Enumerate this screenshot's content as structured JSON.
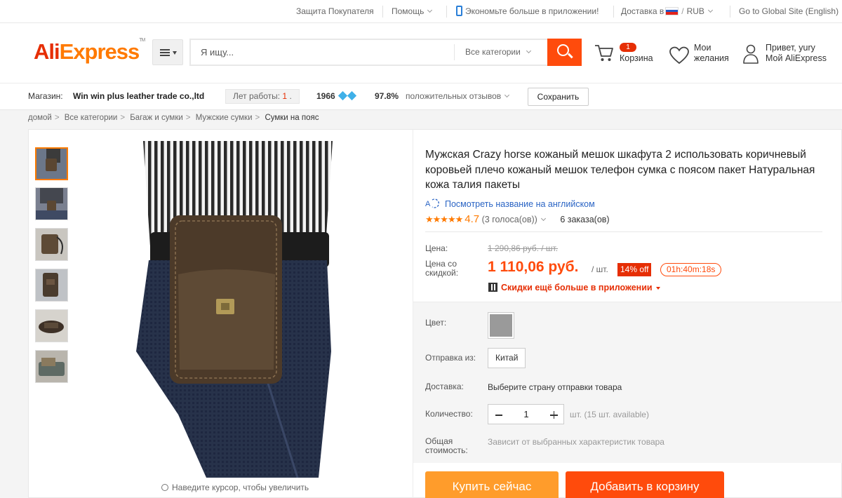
{
  "topbar": {
    "buyer_protection": "Защита Покупателя",
    "help": "Помощь",
    "app_promo": "Экономьте больше в приложении!",
    "delivery_to": "Доставка в",
    "currency": "RUB",
    "global_site": "Go to Global Site (English)"
  },
  "header": {
    "logo_ali": "Ali",
    "logo_express": "Express",
    "search_placeholder": "Я ищу...",
    "category_select": "Все категории",
    "cart_count": "1",
    "cart_label": "Корзина",
    "wishlist_line1": "Мои",
    "wishlist_line2": "желания",
    "greeting": "Привет, yury",
    "my_account": "Мой AliExpress"
  },
  "store": {
    "label": "Магазин:",
    "name": "Win win plus leather trade co.,ltd",
    "years_label": "Лет работы:",
    "years_value": "1",
    "score": "1966",
    "positive_percent": "97.8%",
    "positive_label": "положительных отзывов",
    "save_label": "Сохранить"
  },
  "breadcrumb": [
    "домой",
    "Все категории",
    "Багаж и сумки",
    "Мужские сумки",
    "Сумки на пояс"
  ],
  "gallery": {
    "zoom_hint": "Наведите курсор, чтобы увеличить",
    "thumb_count": 6
  },
  "product": {
    "title": "Мужская Crazy horse кожаный мешок шкафута 2 использовать коричневый коровьей плечо кожаный мешок телефон сумка с поясом пакет Натуральная кожа талия пакеты",
    "translate_link": "Посмотреть название на английском",
    "rating": "4.7",
    "votes": "(3 голоса(ов))",
    "orders": "6 заказа(ов)",
    "price_label": "Цена:",
    "old_price": "1 290,86 руб. / шт.",
    "discount_label": "Цена со скидкой:",
    "new_price": "1 110,06 руб.",
    "unit": "/ шт.",
    "off_badge": "14% off",
    "timer": "01h:40m:18s",
    "app_deal": "Скидки ещё больше в приложении",
    "color_label": "Цвет:",
    "ship_from_label": "Отправка из:",
    "ship_from_value": "Китай",
    "delivery_label": "Доставка:",
    "delivery_value": "Выберите страну отправки товара",
    "qty_label": "Количество:",
    "qty_value": "1",
    "qty_available": "шт. (15 шт. available)",
    "total_label_1": "Общая",
    "total_label_2": "стоимость:",
    "total_value": "Зависит от выбранных характеристик товара",
    "buy_now": "Купить сейчас",
    "add_to_cart": "Добавить в корзину"
  },
  "colors": {
    "brand_red": "#e62e04",
    "brand_orange": "#ff7a00",
    "buy_now_bg": "#ff9c2b",
    "add_to_cart_bg": "#ff4b0c",
    "link_blue": "#2a64c4"
  }
}
